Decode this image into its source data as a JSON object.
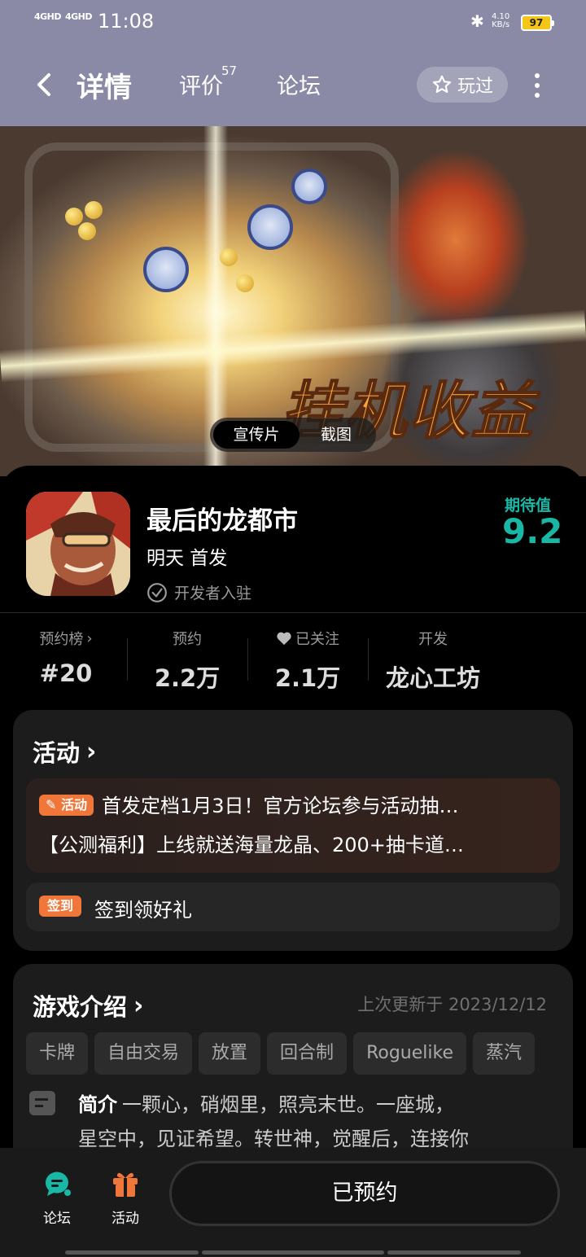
{
  "status_bar": {
    "signal1": "4GHD",
    "signal2": "4GHD",
    "time": "11:08",
    "net_speed_value": "4.10",
    "net_speed_unit": "KB/s",
    "battery": "97"
  },
  "header": {
    "tabs": [
      {
        "label": "详情"
      },
      {
        "label": "评价",
        "count": "57"
      },
      {
        "label": "论坛"
      }
    ],
    "played_label": "玩过"
  },
  "banner": {
    "slogan": "挂机收益",
    "media_tabs": [
      "宣传片",
      "截图"
    ]
  },
  "game": {
    "name": "最后的龙都市",
    "release": "明天 首发",
    "verified": "开发者入驻",
    "expect_label": "期待值",
    "expect_value": "9.2"
  },
  "stats": [
    {
      "label": "预约榜",
      "value": "#20"
    },
    {
      "label": "预约",
      "value": "2.2万"
    },
    {
      "label": "已关注",
      "value": "2.1万"
    },
    {
      "label": "开发",
      "value": "龙心工坊"
    }
  ],
  "activity": {
    "title": "活动",
    "tag": "活动",
    "line1": "首发定档1月3日！官方论坛参与活动抽…",
    "line2": "【公测福利】上线就送海量龙晶、200+抽卡道…",
    "checkin_tag": "签到",
    "checkin_text": "签到领好礼"
  },
  "intro": {
    "title": "游戏介绍",
    "updated": "上次更新于 2023/12/12",
    "tags": [
      "卡牌",
      "自由交易",
      "放置",
      "回合制",
      "Roguelike",
      "蒸汽"
    ],
    "summary_label": "简介",
    "summary_line1": "一颗心，硝烟里，照亮末世。一座城，",
    "summary_line2": "星空中，见证希望。转世神，觉醒后，连接你"
  },
  "bottom": {
    "forum": "论坛",
    "activity": "活动",
    "reserved": "已预约"
  },
  "colors": {
    "accent": "#19b8a6",
    "orange": "#f0763a",
    "header_bg": "#8a8aa6"
  }
}
